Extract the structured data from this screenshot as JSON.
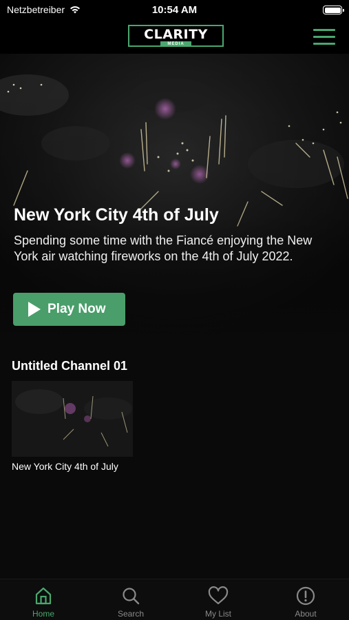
{
  "status_bar": {
    "carrier": "Netzbetreiber",
    "time": "10:54 AM"
  },
  "header": {
    "logo_main": "CLARITY",
    "logo_sub": "MEDIA"
  },
  "hero": {
    "title": "New York City 4th of July",
    "description": "Spending some time with the Fiancé enjoying the New York air watching fireworks on the 4th of July 2022.",
    "play_label": "Play Now"
  },
  "channel": {
    "title": "Untitled Channel 01",
    "items": [
      {
        "label": "New York City 4th of July"
      }
    ]
  },
  "tabs": [
    {
      "label": "Home",
      "icon": "home-icon",
      "active": true
    },
    {
      "label": "Search",
      "icon": "search-icon",
      "active": false
    },
    {
      "label": "My List",
      "icon": "heart-icon",
      "active": false
    },
    {
      "label": "About",
      "icon": "info-icon",
      "active": false
    }
  ],
  "colors": {
    "accent": "#4aa86e",
    "button": "#4a9e6a",
    "background": "#0a0a0a"
  }
}
